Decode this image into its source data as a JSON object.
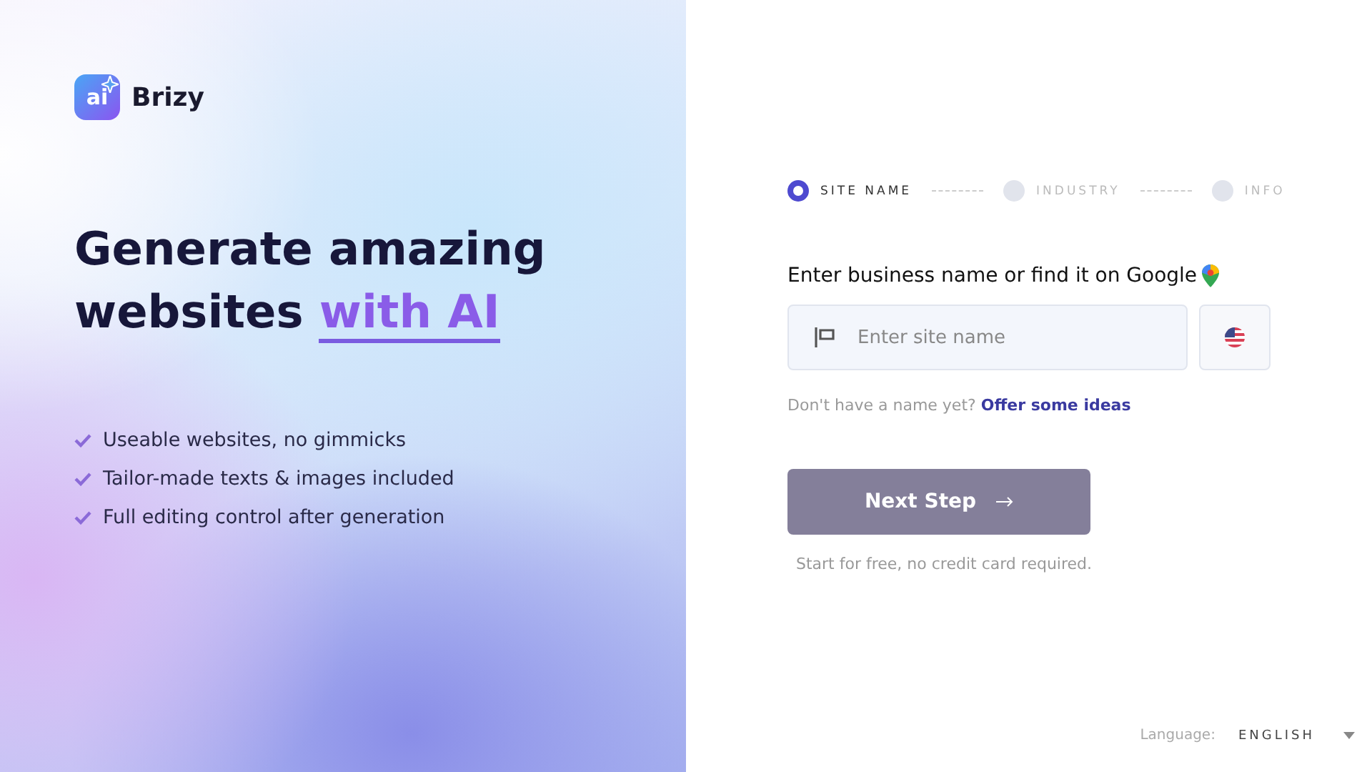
{
  "brand": {
    "mark": "ai",
    "name": "Brizy"
  },
  "heading": {
    "text": "Generate amazing websites",
    "highlight": "with AI"
  },
  "features": [
    {
      "text": "Useable websites, no gimmicks"
    },
    {
      "text": "Tailor-made texts & images included"
    },
    {
      "text": "Full editing control after generation"
    }
  ],
  "steps": [
    {
      "label": "SITE NAME",
      "selected": true
    },
    {
      "label": "INDUSTRY",
      "selected": false
    },
    {
      "label": "INFO",
      "selected": false
    }
  ],
  "form": {
    "label": "Enter business name or find it on Google",
    "placeholder": "Enter site name",
    "hint": "Don't have a name yet?",
    "hint_link": "Offer some ideas",
    "button": {
      "label": "Next Step",
      "disabled": true
    },
    "note": "Start for free, no credit card required."
  },
  "language": {
    "label": "Language:",
    "value": "ENGLISH"
  }
}
